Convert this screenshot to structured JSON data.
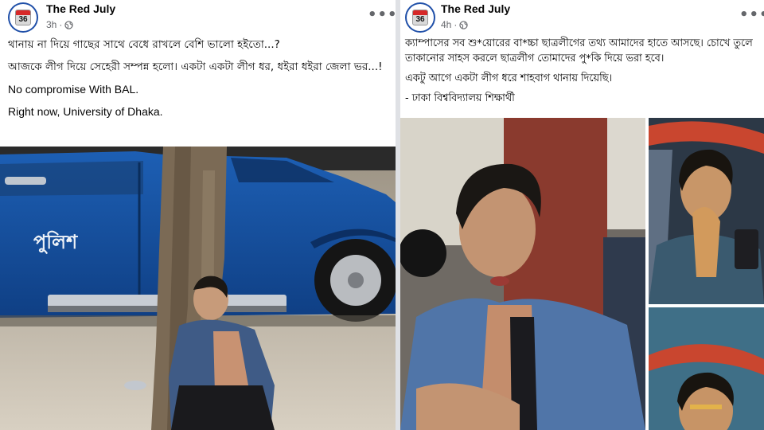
{
  "left_post": {
    "page_name": "The Red July",
    "time": "3h",
    "separator": "·",
    "more_label": "•••",
    "avatar_number": "36",
    "lines": [
      "থানায় না দিয়ে গাছের সাথে বেধে রাখলে বেশি ভালো হইতো...?",
      "আজকে লীগ দিয়ে সেহেরী সম্পন্ন হলো। একটা একটা লীগ ধর, ধইরা ধইরা জেলা ভর...!",
      "No compromise With BAL.",
      "Right now, University of Dhaka."
    ],
    "vehicle_text": "পুলিশ"
  },
  "right_post": {
    "page_name": "The Red July",
    "time": "4h",
    "separator": "·",
    "more_label": "•••",
    "avatar_number": "36",
    "lines": [
      "ক্যাম্পাসের সব শু*য়োরের বা*চ্চা ছাত্রলীগের তথ্য আমাদের হাতে আসছে। চোখে তুলে তাকানোর সাহস করলে ছাত্রলীগ তোমাদের পু*কি দিয়ে ভরা হবে।",
      "একটু আগে একটা লীগ ধরে শাহবাগ থানায় দিয়েছি।",
      "- ঢাকা বিশ্ববিদ্যালয় শিক্ষার্থী"
    ]
  }
}
